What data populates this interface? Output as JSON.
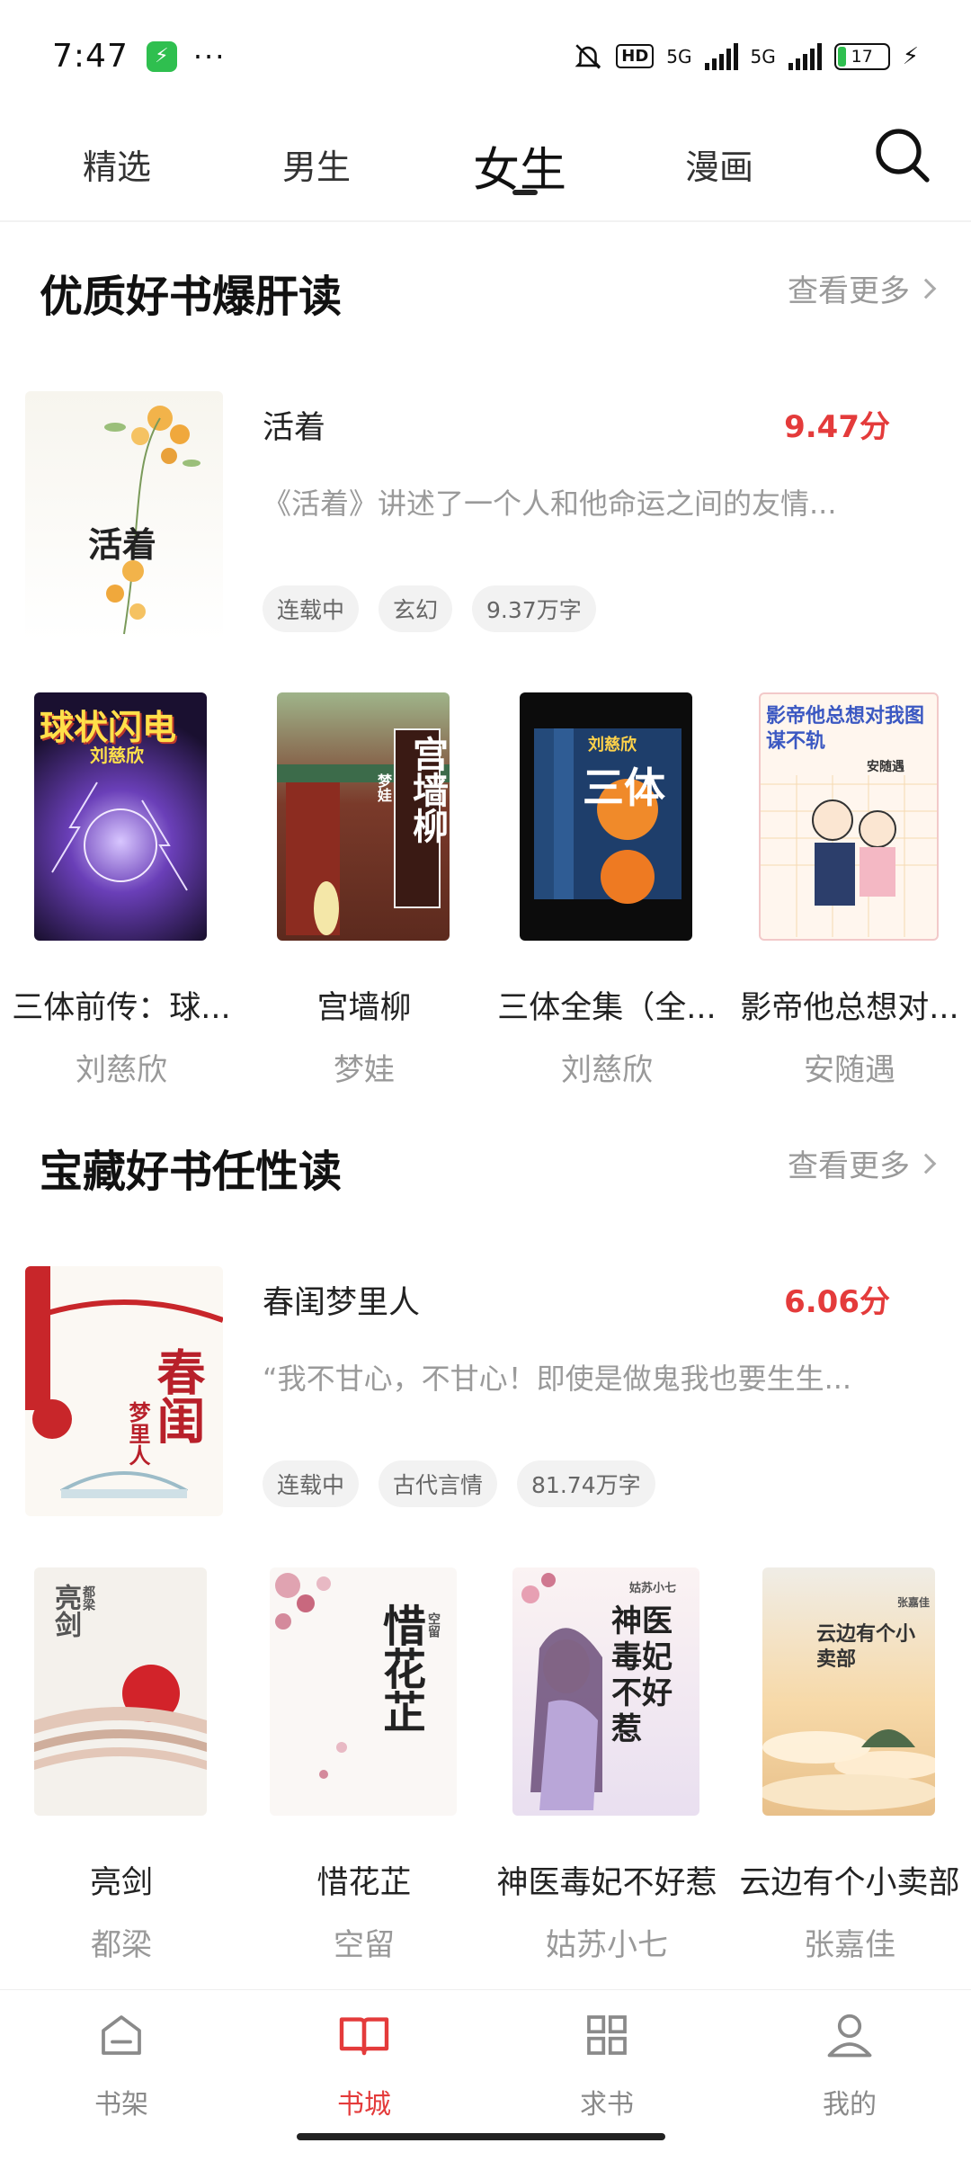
{
  "status_bar": {
    "time": "7:47",
    "dots": "···",
    "hd": "HD",
    "net1": "5G",
    "net2": "5G",
    "battery": "17"
  },
  "top_tabs": [
    {
      "label": "精选",
      "active": false
    },
    {
      "label": "男生",
      "active": false
    },
    {
      "label": "女生",
      "active": true
    },
    {
      "label": "漫画",
      "active": false
    }
  ],
  "sections": [
    {
      "title": "优质好书爆肝读",
      "see_more": "查看更多",
      "featured": {
        "title": "活着",
        "score": "9.47分",
        "desc": "《活着》讲述了一个人和他命运之间的友情...",
        "tags": [
          "连载中",
          "玄幻",
          "9.37万字"
        ],
        "cover_text": "活着"
      },
      "books": [
        {
          "title": "三体前传：球...",
          "author": "刘慈欣",
          "cover_text": "球状闪电",
          "cover_sub": "刘慈欣"
        },
        {
          "title": "宫墙柳",
          "author": "梦娃",
          "cover_text": "宫墙柳",
          "cover_sub": "梦娃"
        },
        {
          "title": "三体全集（全...",
          "author": "刘慈欣",
          "cover_text": "三体",
          "cover_sub": "刘慈欣"
        },
        {
          "title": "影帝他总想对...",
          "author": "安随遇",
          "cover_text": "影帝他总想对我图谋不轨",
          "cover_sub": "安随遇"
        }
      ]
    },
    {
      "title": "宝藏好书任性读",
      "see_more": "查看更多",
      "featured": {
        "title": "春闺梦里人",
        "score": "6.06分",
        "desc": "“我不甘心，不甘心！即使是做鬼我也要生生...",
        "tags": [
          "连载中",
          "古代言情",
          "81.74万字"
        ],
        "cover_text": "春闺",
        "cover_sub": "梦里人"
      },
      "books": [
        {
          "title": "亮剑",
          "author": "都梁",
          "cover_text": "亮剑",
          "cover_sub": "都梁"
        },
        {
          "title": "惜花芷",
          "author": "空留",
          "cover_text": "惜花芷",
          "cover_sub": "空留"
        },
        {
          "title": "神医毒妃不好惹",
          "author": "姑苏小七",
          "cover_text": "神医毒妃不好惹",
          "cover_sub": "姑苏小七"
        },
        {
          "title": "云边有个小卖部",
          "author": "张嘉佳",
          "cover_text": "云边有个小卖部",
          "cover_sub": "张嘉佳"
        }
      ]
    }
  ],
  "bottom_nav": [
    {
      "label": "书架",
      "icon": "bookshelf-icon",
      "active": false
    },
    {
      "label": "书城",
      "icon": "open-book-icon",
      "active": true
    },
    {
      "label": "求书",
      "icon": "grid-icon",
      "active": false
    },
    {
      "label": "我的",
      "icon": "person-icon",
      "active": false
    }
  ],
  "colors": {
    "accent": "#e43b3b",
    "muted": "#999999",
    "tag_bg": "#f2f2f2"
  }
}
